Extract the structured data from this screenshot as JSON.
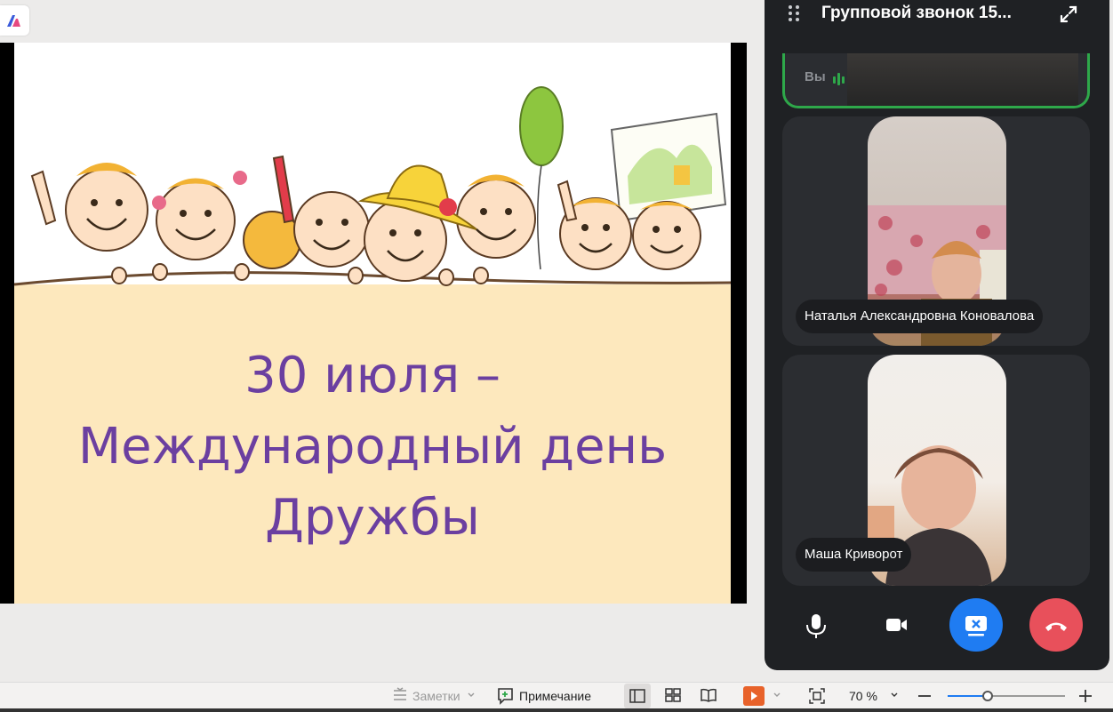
{
  "slide": {
    "title_line1": "30 июля –",
    "title_line2": "Международный день",
    "title_line3": "Дружбы",
    "text_color": "#6b3fa0",
    "background_color": "#fde8bd"
  },
  "call": {
    "title": "Групповой звонок 15...",
    "self_label": "Вы",
    "participants": [
      {
        "name": "Наталья Александровна Коновалова"
      },
      {
        "name": "Маша Криворот"
      }
    ],
    "active_speaker_color": "#2ea84a",
    "share_color": "#1f7cf2",
    "end_call_color": "#e8505b"
  },
  "statusbar": {
    "notes_label": "Заметки",
    "comment_label": "Примечание",
    "zoom_value": "70 %",
    "zoom_level": 0.34
  }
}
